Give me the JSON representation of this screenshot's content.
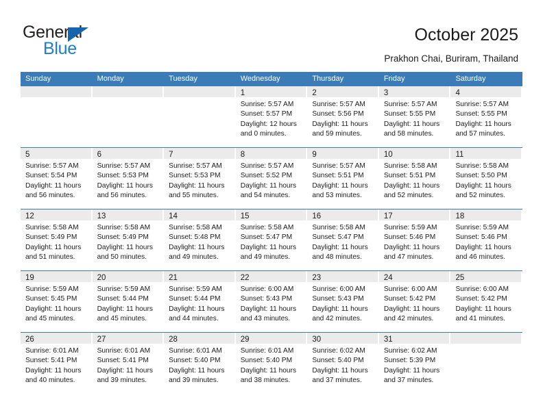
{
  "brand": {
    "name_part1": "General",
    "name_part2": "Blue",
    "accent_color": "#1f7fc4",
    "triangle_color": "#1566ad"
  },
  "header": {
    "title": "October 2025",
    "location": "Prakhon Chai, Buriram, Thailand"
  },
  "calendar": {
    "header_bg": "#3b7bb8",
    "daynum_bg": "#ebebeb",
    "weekdays": [
      "Sunday",
      "Monday",
      "Tuesday",
      "Wednesday",
      "Thursday",
      "Friday",
      "Saturday"
    ],
    "weeks": [
      [
        {
          "day": "",
          "sunrise": "",
          "sunset": "",
          "daylight1": "",
          "daylight2": ""
        },
        {
          "day": "",
          "sunrise": "",
          "sunset": "",
          "daylight1": "",
          "daylight2": ""
        },
        {
          "day": "",
          "sunrise": "",
          "sunset": "",
          "daylight1": "",
          "daylight2": ""
        },
        {
          "day": "1",
          "sunrise": "Sunrise: 5:57 AM",
          "sunset": "Sunset: 5:57 PM",
          "daylight1": "Daylight: 12 hours",
          "daylight2": "and 0 minutes."
        },
        {
          "day": "2",
          "sunrise": "Sunrise: 5:57 AM",
          "sunset": "Sunset: 5:56 PM",
          "daylight1": "Daylight: 11 hours",
          "daylight2": "and 59 minutes."
        },
        {
          "day": "3",
          "sunrise": "Sunrise: 5:57 AM",
          "sunset": "Sunset: 5:55 PM",
          "daylight1": "Daylight: 11 hours",
          "daylight2": "and 58 minutes."
        },
        {
          "day": "4",
          "sunrise": "Sunrise: 5:57 AM",
          "sunset": "Sunset: 5:55 PM",
          "daylight1": "Daylight: 11 hours",
          "daylight2": "and 57 minutes."
        }
      ],
      [
        {
          "day": "5",
          "sunrise": "Sunrise: 5:57 AM",
          "sunset": "Sunset: 5:54 PM",
          "daylight1": "Daylight: 11 hours",
          "daylight2": "and 56 minutes."
        },
        {
          "day": "6",
          "sunrise": "Sunrise: 5:57 AM",
          "sunset": "Sunset: 5:53 PM",
          "daylight1": "Daylight: 11 hours",
          "daylight2": "and 56 minutes."
        },
        {
          "day": "7",
          "sunrise": "Sunrise: 5:57 AM",
          "sunset": "Sunset: 5:53 PM",
          "daylight1": "Daylight: 11 hours",
          "daylight2": "and 55 minutes."
        },
        {
          "day": "8",
          "sunrise": "Sunrise: 5:57 AM",
          "sunset": "Sunset: 5:52 PM",
          "daylight1": "Daylight: 11 hours",
          "daylight2": "and 54 minutes."
        },
        {
          "day": "9",
          "sunrise": "Sunrise: 5:57 AM",
          "sunset": "Sunset: 5:51 PM",
          "daylight1": "Daylight: 11 hours",
          "daylight2": "and 53 minutes."
        },
        {
          "day": "10",
          "sunrise": "Sunrise: 5:58 AM",
          "sunset": "Sunset: 5:51 PM",
          "daylight1": "Daylight: 11 hours",
          "daylight2": "and 52 minutes."
        },
        {
          "day": "11",
          "sunrise": "Sunrise: 5:58 AM",
          "sunset": "Sunset: 5:50 PM",
          "daylight1": "Daylight: 11 hours",
          "daylight2": "and 52 minutes."
        }
      ],
      [
        {
          "day": "12",
          "sunrise": "Sunrise: 5:58 AM",
          "sunset": "Sunset: 5:49 PM",
          "daylight1": "Daylight: 11 hours",
          "daylight2": "and 51 minutes."
        },
        {
          "day": "13",
          "sunrise": "Sunrise: 5:58 AM",
          "sunset": "Sunset: 5:49 PM",
          "daylight1": "Daylight: 11 hours",
          "daylight2": "and 50 minutes."
        },
        {
          "day": "14",
          "sunrise": "Sunrise: 5:58 AM",
          "sunset": "Sunset: 5:48 PM",
          "daylight1": "Daylight: 11 hours",
          "daylight2": "and 49 minutes."
        },
        {
          "day": "15",
          "sunrise": "Sunrise: 5:58 AM",
          "sunset": "Sunset: 5:47 PM",
          "daylight1": "Daylight: 11 hours",
          "daylight2": "and 49 minutes."
        },
        {
          "day": "16",
          "sunrise": "Sunrise: 5:58 AM",
          "sunset": "Sunset: 5:47 PM",
          "daylight1": "Daylight: 11 hours",
          "daylight2": "and 48 minutes."
        },
        {
          "day": "17",
          "sunrise": "Sunrise: 5:59 AM",
          "sunset": "Sunset: 5:46 PM",
          "daylight1": "Daylight: 11 hours",
          "daylight2": "and 47 minutes."
        },
        {
          "day": "18",
          "sunrise": "Sunrise: 5:59 AM",
          "sunset": "Sunset: 5:46 PM",
          "daylight1": "Daylight: 11 hours",
          "daylight2": "and 46 minutes."
        }
      ],
      [
        {
          "day": "19",
          "sunrise": "Sunrise: 5:59 AM",
          "sunset": "Sunset: 5:45 PM",
          "daylight1": "Daylight: 11 hours",
          "daylight2": "and 45 minutes."
        },
        {
          "day": "20",
          "sunrise": "Sunrise: 5:59 AM",
          "sunset": "Sunset: 5:44 PM",
          "daylight1": "Daylight: 11 hours",
          "daylight2": "and 45 minutes."
        },
        {
          "day": "21",
          "sunrise": "Sunrise: 5:59 AM",
          "sunset": "Sunset: 5:44 PM",
          "daylight1": "Daylight: 11 hours",
          "daylight2": "and 44 minutes."
        },
        {
          "day": "22",
          "sunrise": "Sunrise: 6:00 AM",
          "sunset": "Sunset: 5:43 PM",
          "daylight1": "Daylight: 11 hours",
          "daylight2": "and 43 minutes."
        },
        {
          "day": "23",
          "sunrise": "Sunrise: 6:00 AM",
          "sunset": "Sunset: 5:43 PM",
          "daylight1": "Daylight: 11 hours",
          "daylight2": "and 42 minutes."
        },
        {
          "day": "24",
          "sunrise": "Sunrise: 6:00 AM",
          "sunset": "Sunset: 5:42 PM",
          "daylight1": "Daylight: 11 hours",
          "daylight2": "and 42 minutes."
        },
        {
          "day": "25",
          "sunrise": "Sunrise: 6:00 AM",
          "sunset": "Sunset: 5:42 PM",
          "daylight1": "Daylight: 11 hours",
          "daylight2": "and 41 minutes."
        }
      ],
      [
        {
          "day": "26",
          "sunrise": "Sunrise: 6:01 AM",
          "sunset": "Sunset: 5:41 PM",
          "daylight1": "Daylight: 11 hours",
          "daylight2": "and 40 minutes."
        },
        {
          "day": "27",
          "sunrise": "Sunrise: 6:01 AM",
          "sunset": "Sunset: 5:41 PM",
          "daylight1": "Daylight: 11 hours",
          "daylight2": "and 39 minutes."
        },
        {
          "day": "28",
          "sunrise": "Sunrise: 6:01 AM",
          "sunset": "Sunset: 5:40 PM",
          "daylight1": "Daylight: 11 hours",
          "daylight2": "and 39 minutes."
        },
        {
          "day": "29",
          "sunrise": "Sunrise: 6:01 AM",
          "sunset": "Sunset: 5:40 PM",
          "daylight1": "Daylight: 11 hours",
          "daylight2": "and 38 minutes."
        },
        {
          "day": "30",
          "sunrise": "Sunrise: 6:02 AM",
          "sunset": "Sunset: 5:40 PM",
          "daylight1": "Daylight: 11 hours",
          "daylight2": "and 37 minutes."
        },
        {
          "day": "31",
          "sunrise": "Sunrise: 6:02 AM",
          "sunset": "Sunset: 5:39 PM",
          "daylight1": "Daylight: 11 hours",
          "daylight2": "and 37 minutes."
        },
        {
          "day": "",
          "sunrise": "",
          "sunset": "",
          "daylight1": "",
          "daylight2": ""
        }
      ]
    ]
  }
}
